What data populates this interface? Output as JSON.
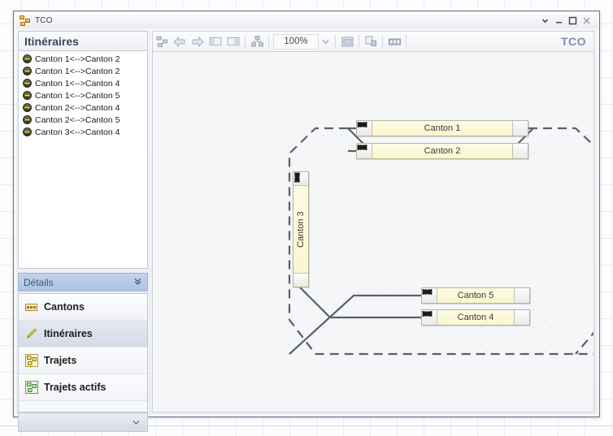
{
  "window": {
    "title": "TCO",
    "icon": "hierarchy-icon",
    "controls": {
      "dropdown": "▾",
      "minimize": "–",
      "maximize": "□",
      "close": "×"
    }
  },
  "sidebar": {
    "header": {
      "title": "Itinéraires"
    },
    "routes": [
      {
        "label": "Canton 1<-->Canton 2",
        "icon": "route-icon"
      },
      {
        "label": "Canton 1<-->Canton 2",
        "icon": "route-icon"
      },
      {
        "label": "Canton 1<-->Canton 4",
        "icon": "route-icon"
      },
      {
        "label": "Canton 1<-->Canton 5",
        "icon": "route-icon"
      },
      {
        "label": "Canton 2<-->Canton 4",
        "icon": "route-icon"
      },
      {
        "label": "Canton 2<-->Canton 5",
        "icon": "route-icon"
      },
      {
        "label": "Canton 3<-->Canton 4",
        "icon": "route-icon"
      }
    ],
    "details_bar": {
      "label": "Détails",
      "chevron": "chevron-double-down-icon"
    },
    "nav_items": [
      {
        "label": "Cantons",
        "icon": "cantons-icon",
        "selected": false
      },
      {
        "label": "Itinéraires",
        "icon": "pencil-icon",
        "selected": true
      },
      {
        "label": "Trajets",
        "icon": "trajets-icon",
        "selected": false
      },
      {
        "label": "Trajets actifs",
        "icon": "trajets-actifs-icon",
        "selected": false
      }
    ],
    "footer": {
      "caret": "caret-down-icon"
    }
  },
  "toolbar": {
    "buttons": [
      {
        "name": "network-view-icon",
        "title": ""
      },
      {
        "name": "arrow-left-icon",
        "title": ""
      },
      {
        "name": "arrow-right-icon",
        "title": ""
      },
      {
        "name": "page-layout-left-icon",
        "title": ""
      },
      {
        "name": "page-layout-right-icon",
        "title": ""
      },
      {
        "name": "hierarchy-icon",
        "title": ""
      }
    ],
    "zoom_value": "100%",
    "zoom_caret": "caret-down-icon",
    "buttons_right": [
      {
        "name": "window-icon",
        "title": ""
      },
      {
        "name": "copy-pages-icon",
        "title": ""
      },
      {
        "name": "filmstrip-icon",
        "title": ""
      }
    ],
    "panel_label": "TCO"
  },
  "diagram": {
    "blocks": [
      {
        "id": "canton1",
        "label": "Canton 1",
        "orientation": "horizontal"
      },
      {
        "id": "canton2",
        "label": "Canton 2",
        "orientation": "horizontal"
      },
      {
        "id": "canton3",
        "label": "Canton 3",
        "orientation": "vertical"
      },
      {
        "id": "canton5",
        "label": "Canton 5",
        "orientation": "horizontal"
      },
      {
        "id": "canton4",
        "label": "Canton 4",
        "orientation": "horizontal"
      }
    ],
    "colors": {
      "block_fill": "#faf6cf",
      "block_border": "#b5b59a",
      "track": "#5a5f6e",
      "canvas_bg": "#f5f6f8"
    }
  }
}
